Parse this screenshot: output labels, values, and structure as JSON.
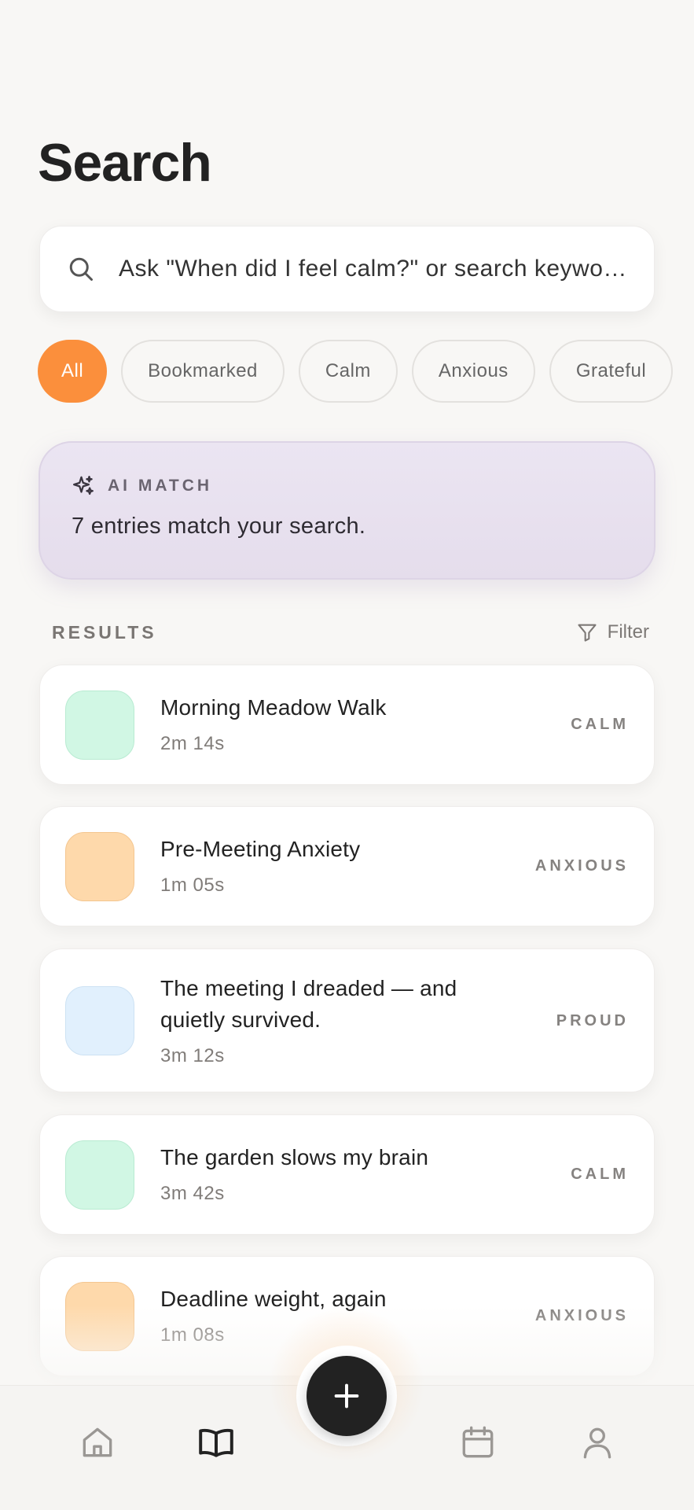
{
  "page": {
    "title": "Search"
  },
  "search": {
    "placeholder": "Ask \"When did I feel calm?\" or search keywords"
  },
  "filters": [
    {
      "label": "All",
      "active": true
    },
    {
      "label": "Bookmarked",
      "active": false
    },
    {
      "label": "Calm",
      "active": false
    },
    {
      "label": "Anxious",
      "active": false
    },
    {
      "label": "Grateful",
      "active": false
    }
  ],
  "ai_match": {
    "label": "AI MATCH",
    "text": "7 entries match your search.",
    "icon": "sparkle-icon"
  },
  "results": {
    "label": "RESULTS",
    "filter_label": "Filter",
    "items": [
      {
        "title": "Morning Meadow Walk",
        "duration": "2m 14s",
        "mood": "CALM",
        "color": "#d1f7e4"
      },
      {
        "title": "Pre-Meeting Anxiety",
        "duration": "1m 05s",
        "mood": "ANXIOUS",
        "color": "#fed9ab"
      },
      {
        "title": "The meeting I dreaded — and quietly survived.",
        "duration": "3m 12s",
        "mood": "PROUD",
        "color": "#e1f0fd"
      },
      {
        "title": "The garden slows my brain",
        "duration": "3m 42s",
        "mood": "CALM",
        "color": "#d1f7e4"
      },
      {
        "title": "Deadline weight, again",
        "duration": "1m 08s",
        "mood": "ANXIOUS",
        "color": "#fed9ab"
      }
    ]
  },
  "nav": {
    "items": [
      "home-icon",
      "journal-icon",
      "calendar-icon",
      "profile-icon"
    ],
    "active": "journal-icon",
    "fab": "plus-icon"
  },
  "colors": {
    "accent": "#fb8f3c",
    "ai_card": "#e7dfee",
    "fab": "#222222"
  }
}
